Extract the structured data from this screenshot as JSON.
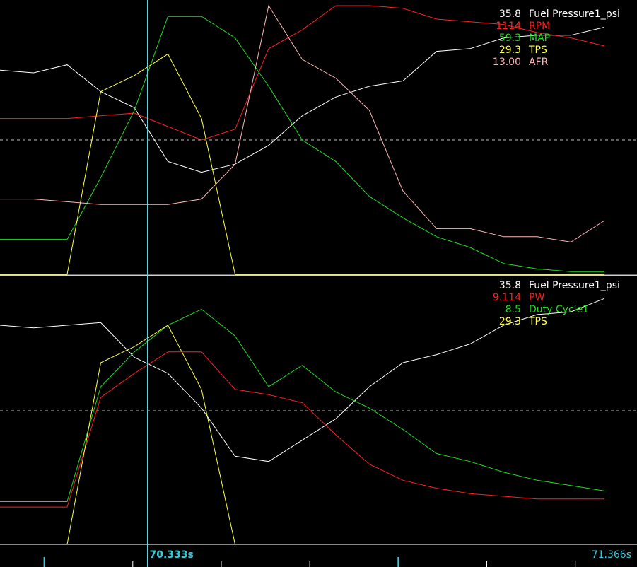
{
  "chart_data": [
    {
      "type": "line",
      "panel": "top",
      "y_scale": [
        0,
        100
      ],
      "legend_placement": "top-right",
      "grid": "dashed-midline",
      "series": [
        {
          "name": "Fuel Pressure1_psi",
          "value_label": "35.8",
          "color": "#ffffff",
          "values": [
            76,
            75,
            78,
            68,
            62,
            42,
            38,
            41,
            48,
            59,
            66,
            70,
            72,
            83,
            84,
            88,
            89,
            89,
            92
          ]
        },
        {
          "name": "RPM",
          "value_label": "1114",
          "color": "#ff2020",
          "values": [
            58,
            58,
            58,
            59,
            60,
            55,
            50,
            54,
            84,
            91,
            100,
            100,
            99,
            95,
            94,
            93,
            90,
            88,
            85
          ]
        },
        {
          "name": "MAP",
          "value_label": "59.3",
          "color": "#22dd22",
          "values": [
            13,
            13,
            13,
            36,
            61,
            96,
            96,
            88,
            70,
            50,
            42,
            29,
            21,
            14,
            10,
            4,
            2,
            1,
            1
          ]
        },
        {
          "name": "TPS",
          "value_label": "29.3",
          "color": "#ffff44",
          "values": [
            0,
            0,
            0,
            68,
            74,
            82,
            58,
            0,
            0,
            0,
            0,
            0,
            0,
            0,
            0,
            0,
            0,
            0,
            0
          ]
        },
        {
          "name": "AFR",
          "value_label": "13.00",
          "color": "#ffb6b6",
          "values": [
            28,
            28,
            27,
            26,
            26,
            26,
            28,
            41,
            100,
            80,
            73,
            61,
            31,
            17,
            17,
            14,
            14,
            12,
            20
          ]
        }
      ]
    },
    {
      "type": "line",
      "panel": "bottom",
      "y_scale": [
        0,
        100
      ],
      "legend_placement": "top-right",
      "grid": "dashed-midline",
      "series": [
        {
          "name": "Fuel Pressure1_psi",
          "value_label": "35.8",
          "color": "#ffffff",
          "values": [
            82,
            81,
            82,
            83,
            70,
            64,
            51,
            33,
            31,
            39,
            47,
            59,
            68,
            71,
            75,
            82,
            86,
            87,
            92
          ]
        },
        {
          "name": "PW",
          "value_label": "9.114",
          "color": "#ff2020",
          "values": [
            14,
            14,
            14,
            55,
            64,
            72,
            72,
            58,
            56,
            53,
            41,
            30,
            24,
            21,
            19,
            18,
            17,
            17,
            17
          ]
        },
        {
          "name": "Duty Cycle1",
          "value_label": "8.5",
          "color": "#22dd22",
          "values": [
            16,
            16,
            16,
            59,
            72,
            82,
            88,
            78,
            59,
            67,
            57,
            51,
            43,
            34,
            31,
            27,
            24,
            22,
            20
          ]
        },
        {
          "name": "TPS",
          "value_label": "29.3",
          "color": "#ffff44",
          "values": [
            0,
            0,
            0,
            68,
            74,
            82,
            58,
            0,
            0,
            0,
            0,
            0,
            0,
            0,
            0,
            0,
            0,
            0,
            0
          ]
        }
      ]
    }
  ],
  "x_axis": {
    "start": 70.0,
    "end": 71.366,
    "cursor_time": 70.333,
    "cursor_label": "70.333s",
    "end_label": "71.366s",
    "ticks_major": [
      70.1,
      70.9
    ],
    "ticks_minor": [
      70.3,
      70.5,
      70.7,
      71.1,
      71.3
    ]
  },
  "colors": {
    "background": "#000000",
    "cursor": "#5fd3e0",
    "divider": "#cfcfcf",
    "grid": "#bbbbbb",
    "axis_label": "#38c8d8"
  }
}
